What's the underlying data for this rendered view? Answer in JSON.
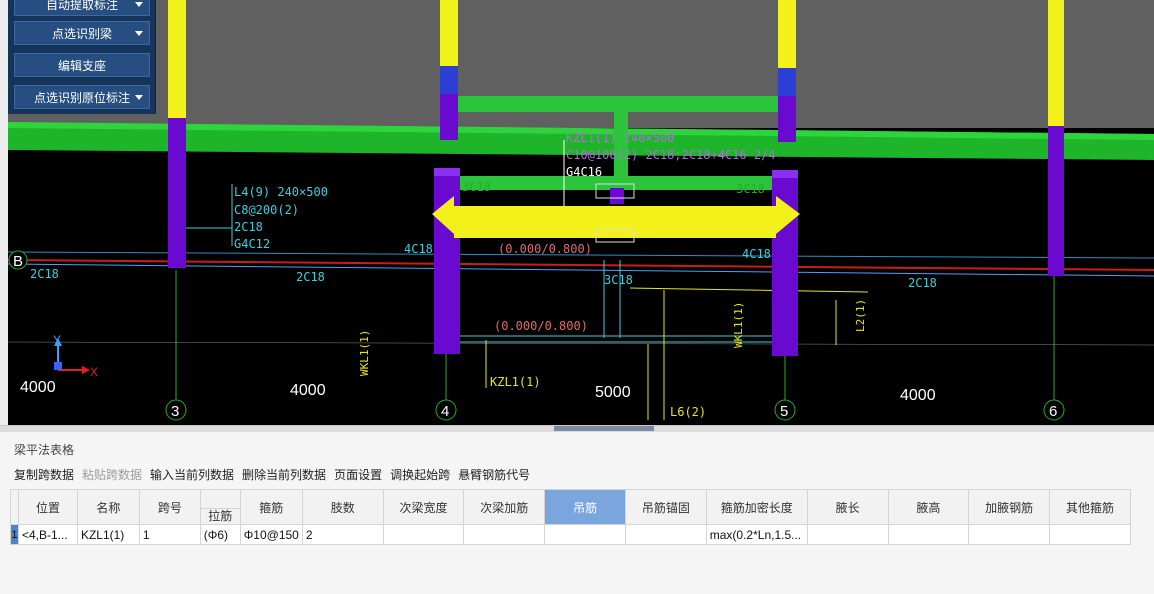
{
  "toolbar_float": {
    "btn_auto": "自动提取标注",
    "btn_pick_beam": "点选识别梁",
    "btn_edit_support": "编辑支座",
    "btn_pick_inplace": "点选识别原位标注"
  },
  "cad": {
    "axis_b": "B",
    "axis_3": "3",
    "axis_4": "4",
    "axis_5": "5",
    "axis_6": "6",
    "dim_left": "4000",
    "dim_34": "4000",
    "dim_45": "5000",
    "dim_56": "4000",
    "ucs_x": "X",
    "ucs_y": "Y",
    "l4_line1": "L4(9) 240×500",
    "l4_line2": "C8@200(2)",
    "l4_line3": "2C18",
    "l4_line4": "G4C12",
    "kzl_line1": "KZL1(1) 240×500",
    "kzl_line2": "C10@100(2) 2C18;2C18+4C16 2/4",
    "kzl_line3": "G4C16",
    "label_2c18_a": "2C18",
    "label_2c18_b": "2C18",
    "label_2c18_c": "2C18",
    "label_4c18_a": "4C18",
    "label_4c18_b": "4C18",
    "label_3c18_a": "3C18",
    "label_3c18_b": "3C18",
    "label_3c18_c": "3C18",
    "elev_a": "(0.000/0.800)",
    "elev_b": "(0.000/0.800)",
    "vlabel_wkl_a": "WKL1(1)",
    "vlabel_wkl_b": "WKL1(1)",
    "vlabel_l2": "L2(1)",
    "label_kzl1": "KZL1(1)",
    "label_l6": "L6(2)"
  },
  "panel": {
    "title": "梁平法表格",
    "toolbar": [
      {
        "label": "复制跨数据",
        "enabled": true
      },
      {
        "label": "粘贴跨数据",
        "enabled": false
      },
      {
        "label": "输入当前列数据",
        "enabled": true
      },
      {
        "label": "删除当前列数据",
        "enabled": true
      },
      {
        "label": "页面设置",
        "enabled": true
      },
      {
        "label": "调换起始跨",
        "enabled": true
      },
      {
        "label": "悬臂钢筋代号",
        "enabled": true
      }
    ],
    "headers": {
      "position": "位置",
      "name": "名称",
      "span": "跨号",
      "tie_bar": "拉筋",
      "stirrup": "箍筋",
      "legs": "肢数",
      "sec_width": "次梁宽度",
      "sec_add": "次梁加筋",
      "hanger": "吊筋",
      "hanger_anchor": "吊筋锚固",
      "densify_len": "箍筋加密长度",
      "haunch_len": "腋长",
      "haunch_h": "腋高",
      "haunch_bar": "加腋钢筋",
      "other_stirrup": "其他箍筋"
    },
    "row": {
      "num": "1",
      "position": "<4,B-1...",
      "name": "KZL1(1)",
      "span": "1",
      "tie_bar": "(Φ6)",
      "stirrup": "Φ10@150",
      "legs": "2",
      "sec_width": "",
      "sec_add": "",
      "hanger": "",
      "hanger_anchor": "",
      "densify_len": "max(0.2*Ln,1.5...",
      "haunch_len": "",
      "haunch_h": "",
      "haunch_bar": "",
      "other_stirrup": ""
    }
  },
  "colors": {
    "cad_bg": "#000000",
    "beam_green": "#1fb52b",
    "column_purple": "#6a0ad0",
    "column_yellow": "#f2f21a",
    "active_header": "#7aa6dd"
  }
}
